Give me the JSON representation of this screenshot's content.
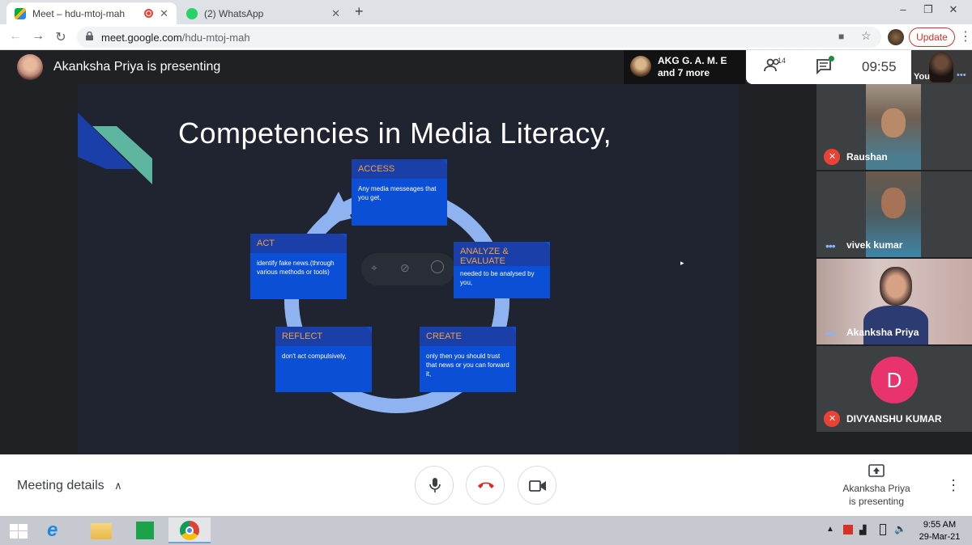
{
  "browser": {
    "tabs": [
      {
        "title": "Meet – hdu-mtoj-mah",
        "active": true
      },
      {
        "title": "(2) WhatsApp",
        "active": false
      }
    ],
    "url_host": "meet.google.com",
    "url_path": "/hdu-mtoj-mah",
    "update_label": "Update"
  },
  "meet": {
    "presenting_title": "Akanksha Priya is presenting",
    "group_line1": "AKG G. A. M. E",
    "group_line2": "and 7 more",
    "participants_count": "14",
    "time": "09:55",
    "self_label": "You"
  },
  "slide": {
    "title": "Competencies in Media Literacy,",
    "boxes": {
      "access": {
        "heading": "ACCESS",
        "body": "Any media messeages that you get,"
      },
      "analyze": {
        "heading": "ANALYZE & EVALUATE",
        "body": "needed  to be analysed by you,"
      },
      "create": {
        "heading": "CREATE",
        "body": "only then you should trust that news or you can forward it,"
      },
      "reflect": {
        "heading": "REFLECT",
        "body": "don't act compulsively,"
      },
      "act": {
        "heading": "ACT",
        "body": "identify fake news.(through various methods or tools)"
      }
    }
  },
  "participants": [
    {
      "name": "Raushan",
      "muted": true
    },
    {
      "name": "vivek kumar",
      "muted": false
    },
    {
      "name": "Akanksha Priya",
      "muted": false
    },
    {
      "name": "DIVYANSHU KUMAR",
      "muted": true,
      "initial": "D"
    }
  ],
  "bottom": {
    "meeting_details": "Meeting details",
    "present_line1": "Akanksha Priya",
    "present_line2": "is presenting"
  },
  "taskbar": {
    "time": "9:55 AM",
    "date": "29-Mar-21"
  },
  "colors": {
    "meet_red": "#ea4335",
    "slide_box_blue": "#0b4fd6",
    "slide_heading_orange": "#f4a13c",
    "avatar_pink": "#e8336d"
  }
}
